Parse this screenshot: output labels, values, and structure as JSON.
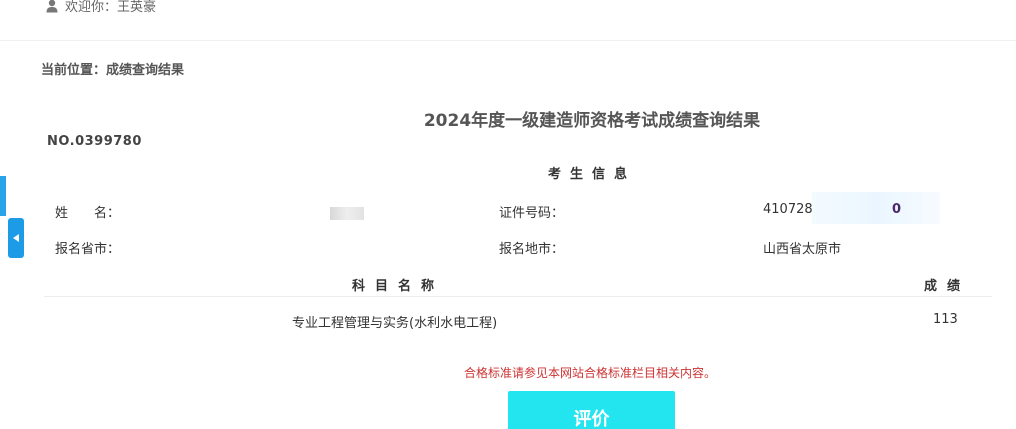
{
  "header": {
    "welcome_text": "欢迎你：王英豪",
    "user_icon": "user-icon"
  },
  "breadcrumb": "当前位置：成绩查询结果",
  "page_title": "2024年度一级建造师资格考试成绩查询结果",
  "cert_no": "NO.0399780",
  "candidate_info": {
    "section_title": "考生信息",
    "name_label": "姓　　名：",
    "id_label": "证件号码：",
    "id_value_prefix": "410728",
    "id_value_suffix": "0",
    "province_label": "报名省市：",
    "city_label": "报名地市：",
    "city_value": "山西省太原市"
  },
  "scores_table": {
    "columns": [
      "科目名称",
      "成绩"
    ],
    "rows": [
      {
        "subject": "专业工程管理与实务(水利水电工程)",
        "score": "113"
      }
    ]
  },
  "notice": "合格标准请参见本网站合格标准栏目相关内容。",
  "evaluate_button": "评价",
  "colors": {
    "accent": "#22e5ef",
    "side_tab": "#1e9be6",
    "notice": "#cc3333"
  }
}
